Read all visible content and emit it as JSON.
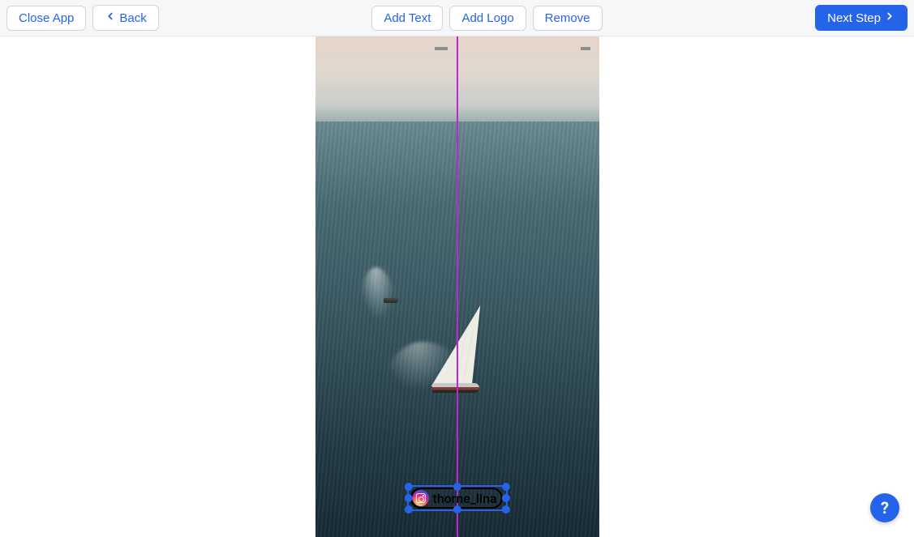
{
  "toolbar": {
    "close_label": "Close App",
    "back_label": "Back",
    "add_text_label": "Add Text",
    "add_logo_label": "Add Logo",
    "remove_label": "Remove",
    "next_label": "Next Step"
  },
  "canvas": {
    "guide_color": "#c026d3",
    "selection_color": "#2563eb"
  },
  "overlay": {
    "type": "instagram-handle",
    "username": "thorne_lina",
    "selected": true
  },
  "help": {
    "glyph": "?"
  }
}
